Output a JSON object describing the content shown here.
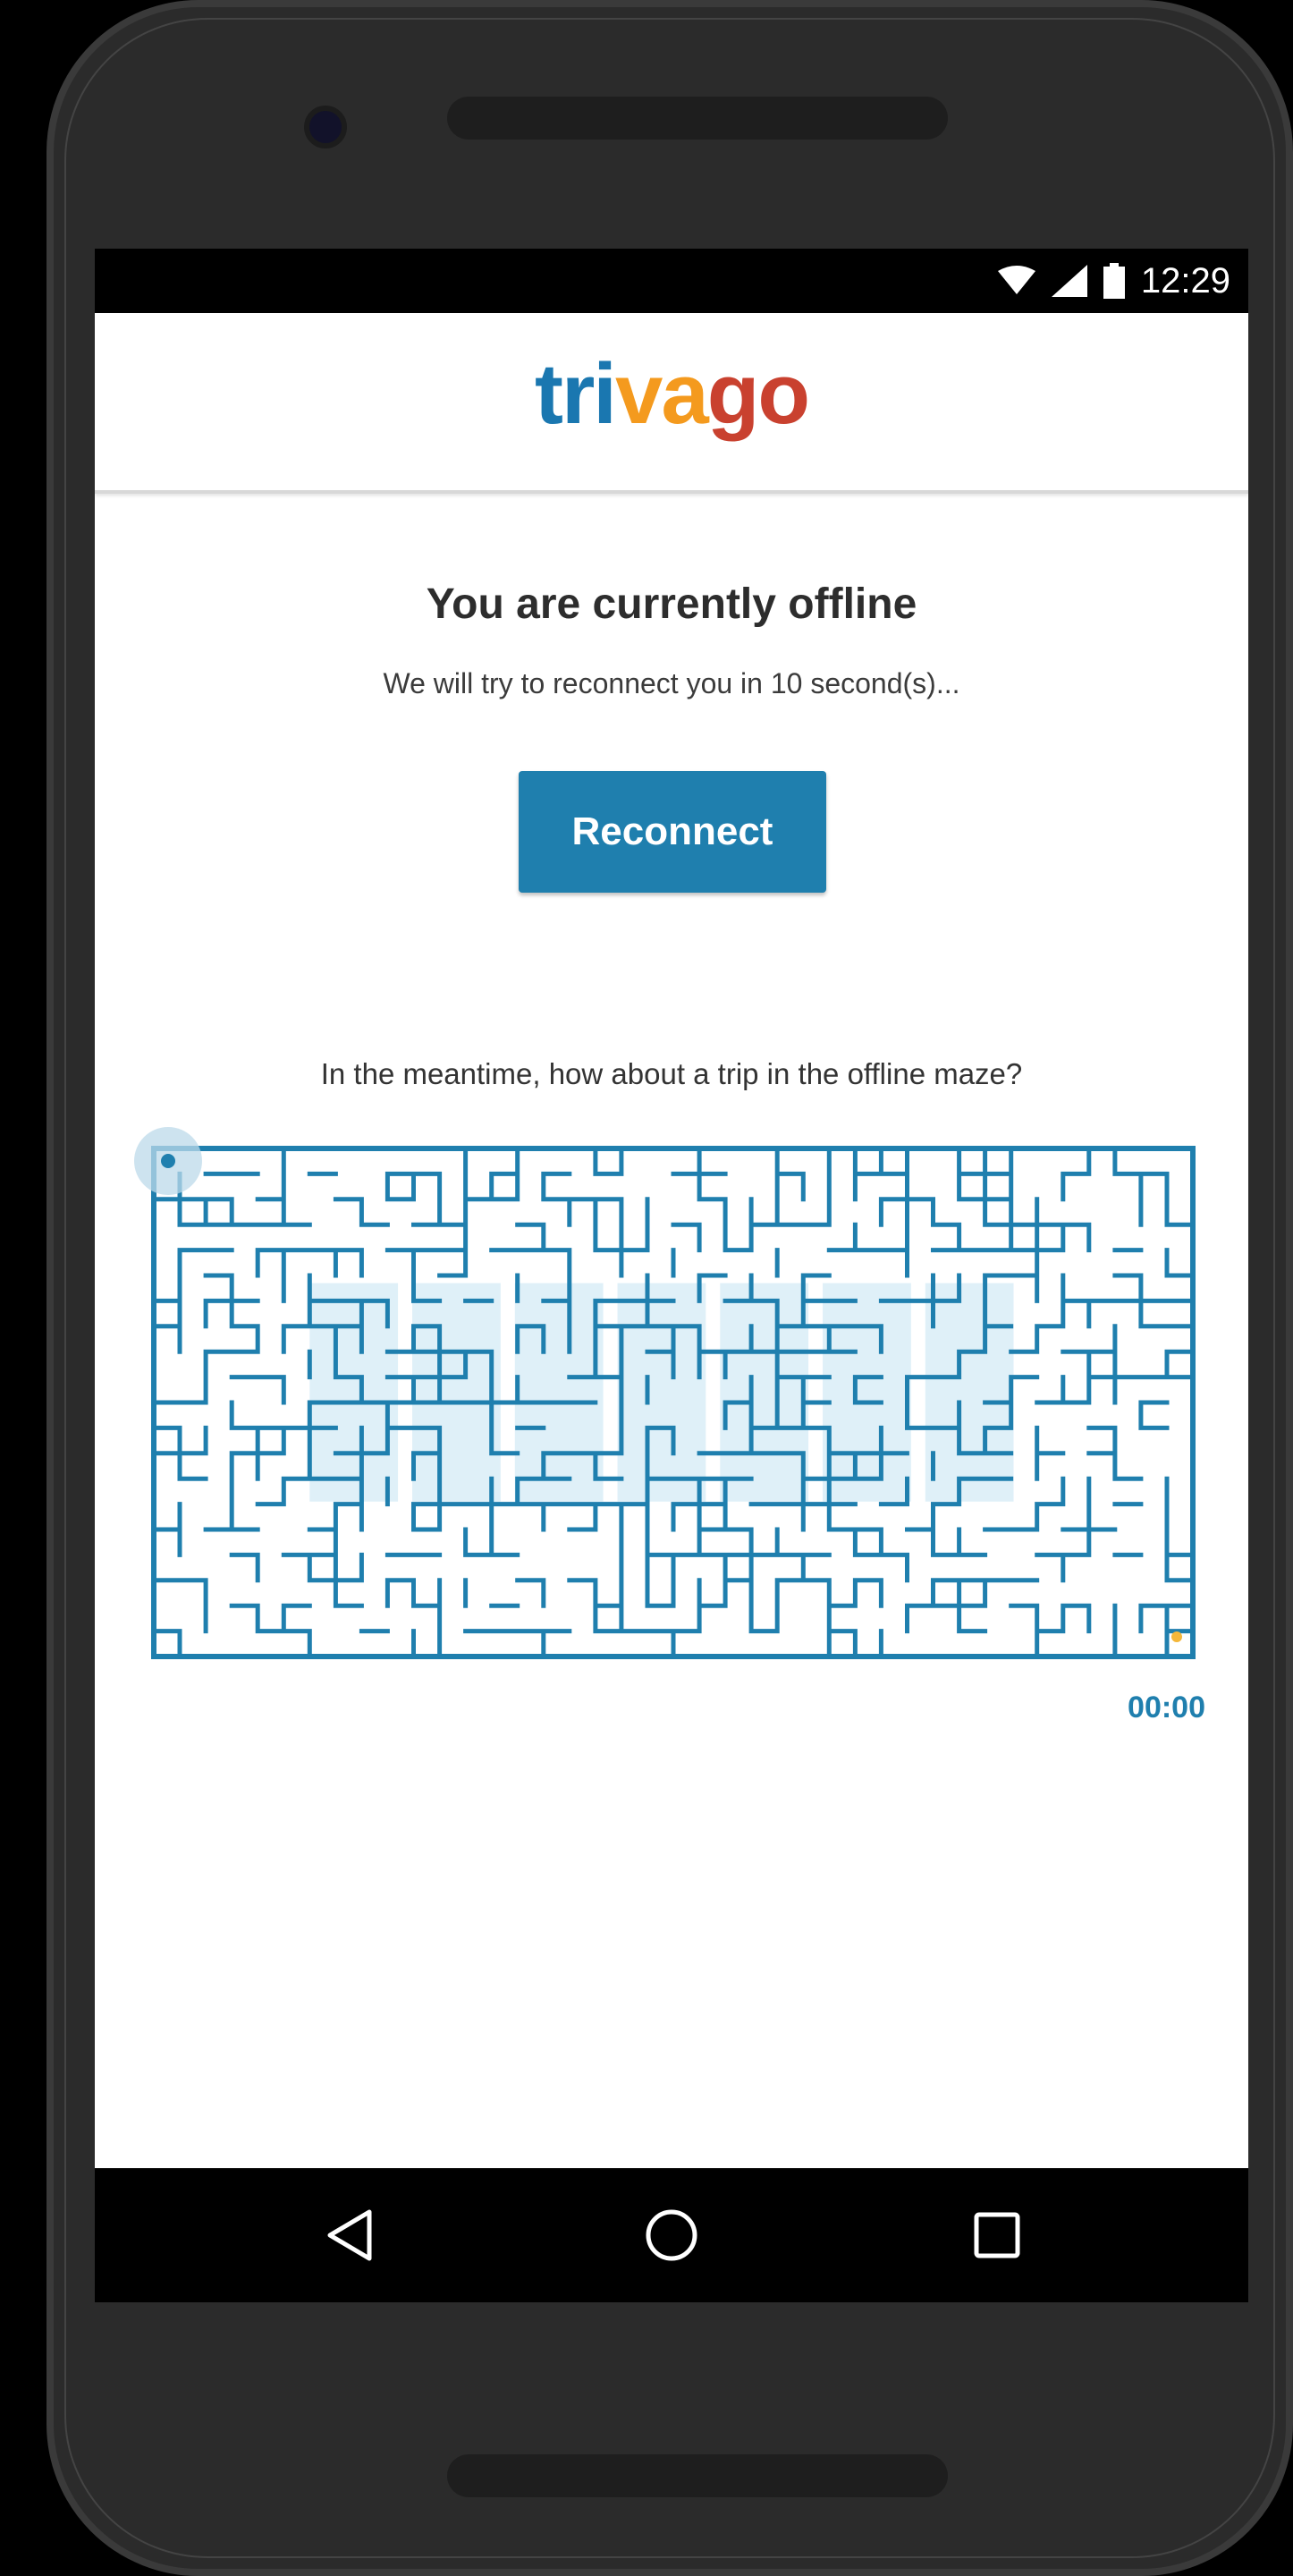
{
  "status_bar": {
    "time": "12:29"
  },
  "app_bar": {
    "logo": {
      "part1": "tri",
      "part2": "va",
      "part3": "go"
    }
  },
  "offline": {
    "title": "You are currently offline",
    "subtitle": "We will try to reconnect you in 10 second(s)...",
    "reconnect_label": "Reconnect"
  },
  "maze": {
    "prompt": "In the meantime, how about a trip in the offline maze?",
    "word": "OFFLINE",
    "timer": "00:00"
  },
  "colors": {
    "brand_blue": "#1f7fae",
    "logo_blue": "#1a77b0",
    "logo_orange": "#f49a1e",
    "logo_red": "#c9412f",
    "goal_dot": "#f4b73a"
  },
  "nav_bar": {
    "icons": [
      "back-icon",
      "home-icon",
      "recents-icon"
    ]
  }
}
